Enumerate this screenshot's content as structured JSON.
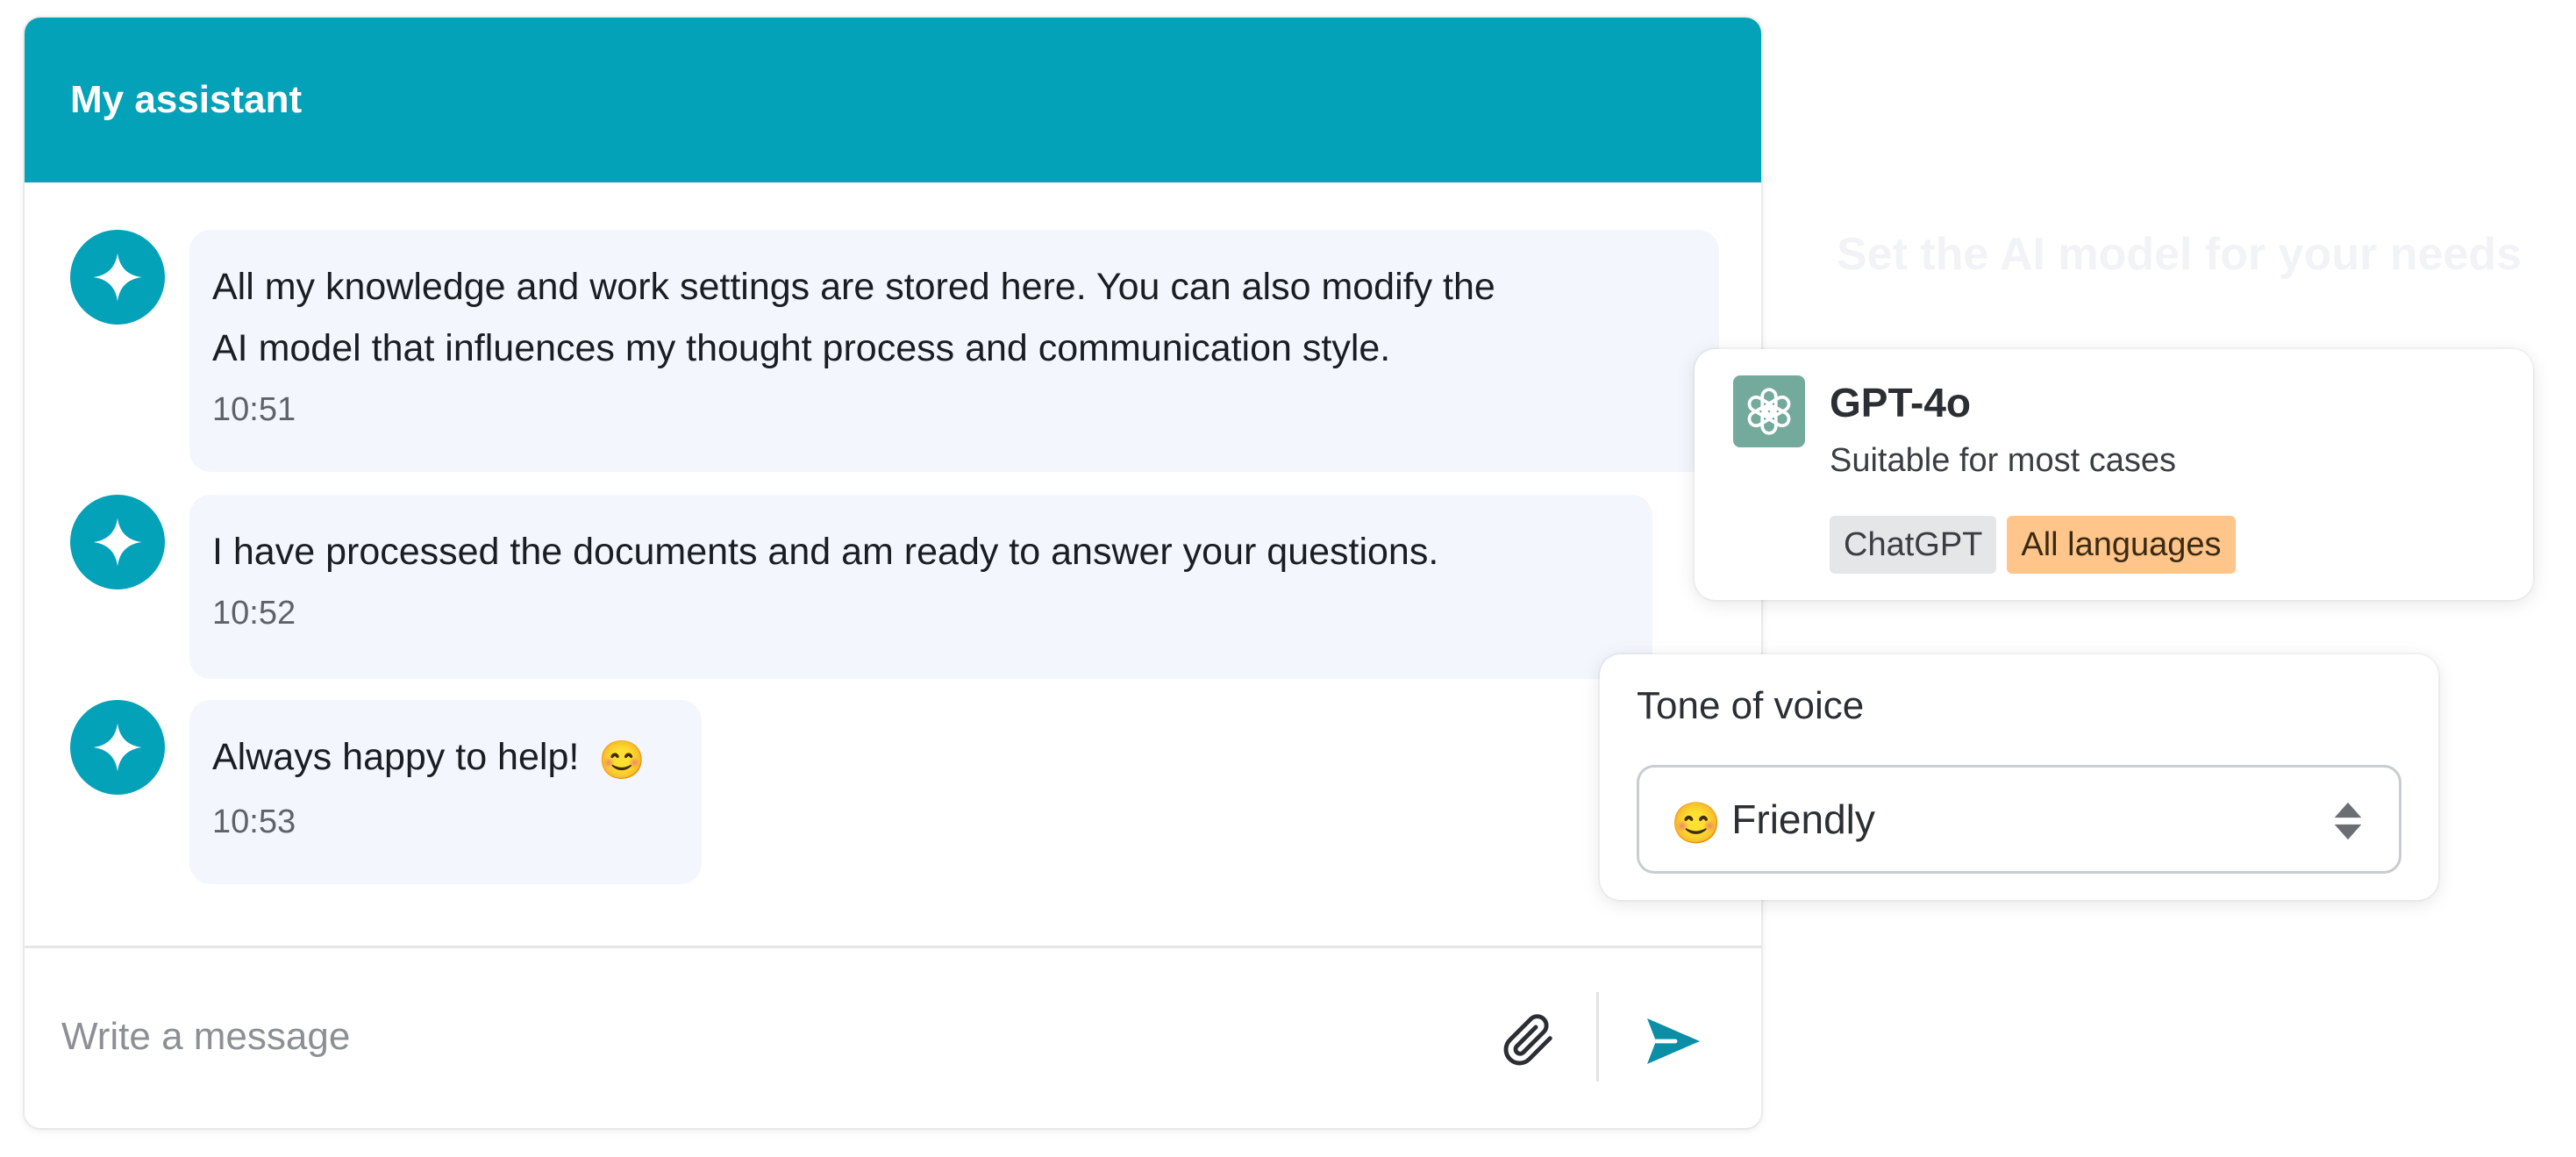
{
  "chat": {
    "title": "My assistant",
    "messages": [
      {
        "text": "All my knowledge and work settings are stored here. You can also modify the\nAI model that influences my thought process and communication style.",
        "time": "10:51"
      },
      {
        "text": "I have processed the documents and am ready to answer your questions.",
        "time": "10:52"
      },
      {
        "text": "Always happy to help!",
        "emoji": "😊",
        "time": "10:53"
      }
    ],
    "input": {
      "placeholder": "Write a message",
      "value": ""
    }
  },
  "panel": {
    "heading": "Set the AI model for your needs"
  },
  "model": {
    "name": "GPT-4o",
    "description": "Suitable for most cases",
    "tags": [
      "ChatGPT",
      "All languages"
    ]
  },
  "tone": {
    "label": "Tone of voice",
    "selected_emoji": "😊",
    "selected": "Friendly"
  },
  "colors": {
    "header": "#03a2b8",
    "bubble": "#f3f6fd",
    "send_icon": "#0a8fa6",
    "tag_orange": "#ffc58a",
    "tag_grey": "#e5e6e8",
    "model_logo": "#74aa9c"
  },
  "icons": {
    "avatar": "sparkle-icon",
    "attach": "paperclip-icon",
    "send": "send-icon",
    "model": "openai-logo-icon",
    "select": "updown-arrows-icon"
  }
}
